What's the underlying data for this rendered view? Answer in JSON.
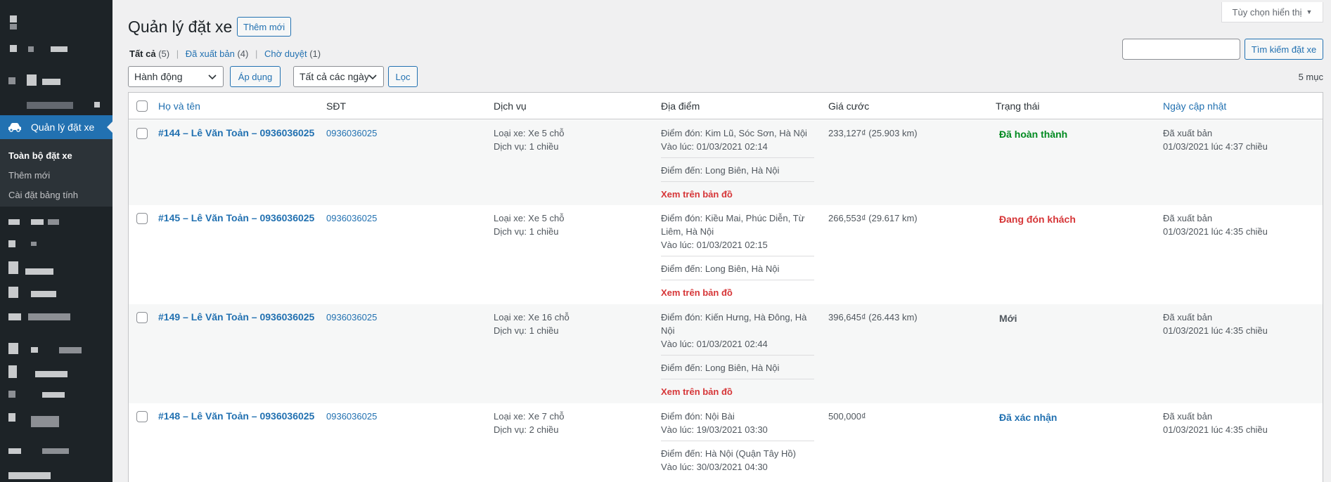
{
  "sidebar": {
    "active_menu": "Quản lý đặt xe",
    "submenu": [
      "Toàn bộ đặt xe",
      "Thêm mới",
      "Cài đặt bảng tính"
    ]
  },
  "header": {
    "title": "Quản lý đặt xe",
    "add_new": "Thêm mới",
    "screen_options": "Tùy chọn hiển thị"
  },
  "views": {
    "all": {
      "label": "Tất cả",
      "count": "(5)"
    },
    "published": {
      "label": "Đã xuất bản",
      "count": "(4)"
    },
    "pending": {
      "label": "Chờ duyệt",
      "count": "(1)"
    }
  },
  "search": {
    "value": "",
    "button": "Tìm kiếm đặt xe"
  },
  "bulk": {
    "action": "Hành động",
    "apply": "Áp dụng",
    "date": "Tất cả các ngày",
    "filter": "Lọc"
  },
  "item_count": "5 mục",
  "columns": [
    "Họ và tên",
    "SĐT",
    "Dịch vụ",
    "Địa điểm",
    "Giá cước",
    "Trạng thái",
    "Ngày cập nhật"
  ],
  "rows": [
    {
      "title": "#144 – Lê Văn Toản – 0936036025",
      "phone": "0936036025",
      "service": [
        "Loại xe: Xe 5 chỗ",
        "Dịch vụ: 1 chiều"
      ],
      "pickup": [
        "Điểm đón: Kim Lũ, Sóc Sơn, Hà Nội",
        "Vào lúc: 01/03/2021 02:14"
      ],
      "dropoff": [
        "Điểm đến: Long Biên, Hà Nội"
      ],
      "map": "Xem trên bản đồ",
      "price": "233,127₫ (25.903 km)",
      "status": "Đã hoàn thành",
      "status_color": "#008a20",
      "updated": [
        "Đã xuất bản",
        "01/03/2021 lúc 4:37 chiều"
      ]
    },
    {
      "title": "#145 – Lê Văn Toản – 0936036025",
      "phone": "0936036025",
      "service": [
        "Loại xe: Xe 5 chỗ",
        "Dịch vụ: 1 chiều"
      ],
      "pickup": [
        "Điểm đón: Kiều Mai, Phúc Diễn, Từ",
        "Liêm, Hà Nội",
        "Vào lúc: 01/03/2021 02:15"
      ],
      "dropoff": [
        "Điểm đến: Long Biên, Hà Nội"
      ],
      "map": "Xem trên bản đồ",
      "price": "266,553₫ (29.617 km)",
      "status": "Đang đón khách",
      "status_color": "#d63638",
      "updated": [
        "Đã xuất bản",
        "01/03/2021 lúc 4:35 chiều"
      ]
    },
    {
      "title": "#149 – Lê Văn Toản – 0936036025",
      "phone": "0936036025",
      "service": [
        "Loại xe: Xe 16 chỗ",
        "Dịch vụ: 1 chiều"
      ],
      "pickup": [
        "Điểm đón: Kiến Hưng, Hà Đông, Hà",
        "Nội",
        "Vào lúc: 01/03/2021 02:44"
      ],
      "dropoff": [
        "Điểm đến: Long Biên, Hà Nội"
      ],
      "map": "Xem trên bản đồ",
      "price": "396,645₫ (26.443 km)",
      "status": "Mới",
      "status_color": "#50575e",
      "updated": [
        "Đã xuất bản",
        "01/03/2021 lúc 4:35 chiều"
      ]
    },
    {
      "title": "#148 – Lê Văn Toản – 0936036025",
      "phone": "0936036025",
      "service": [
        "Loại xe: Xe 7 chỗ",
        "Dịch vụ: 2 chiều"
      ],
      "pickup": [
        "Điểm đón: Nội Bài",
        "Vào lúc: 19/03/2021 03:30"
      ],
      "dropoff": [
        "Điểm đến: Hà Nội (Quận Tây Hồ)",
        "Vào lúc: 30/03/2021 04:30"
      ],
      "map": "",
      "price": "500,000₫",
      "status": "Đã xác nhận",
      "status_color": "#2271b1",
      "updated": [
        "Đã xuất bản",
        "01/03/2021 lúc 4:35 chiều"
      ]
    }
  ]
}
